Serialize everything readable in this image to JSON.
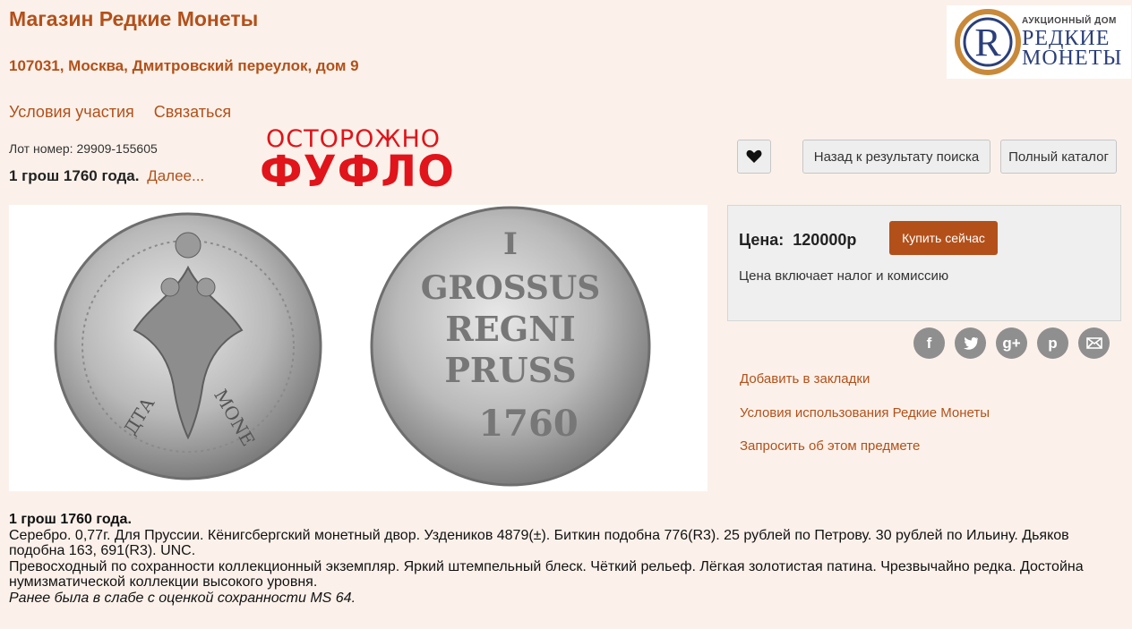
{
  "header": {
    "shop_title": "Магазин Редкие Монеты",
    "address": "107031, Москва, Дмитровский переулок, дом 9"
  },
  "logo": {
    "line1": "АУКЦИОННЫЙ ДОМ",
    "line2": "РЕДКИЕ",
    "line3": "МОНЕТЫ"
  },
  "nav": {
    "terms": "Условия участия",
    "contact": "Связаться"
  },
  "lot": {
    "number_text": "Лот номер: 29909-155605",
    "title": "1 грош 1760 года.",
    "more": "Далее..."
  },
  "overlay": {
    "top": "ОСТОРОЖНО",
    "main": "ФУФЛО"
  },
  "toolbar": {
    "back_label": "Назад к результату поиска",
    "catalog_label": "Полный каталог"
  },
  "coin": {
    "reverse_lines": [
      "I",
      "GROSSUS",
      "REGNI",
      "PRUSS",
      "1760"
    ]
  },
  "price": {
    "label": "Цена:",
    "value": "120000р",
    "buy_label": "Купить сейчас",
    "note": "Цена включает налог и комиссию"
  },
  "social": [
    "facebook-icon",
    "twitter-icon",
    "google-plus-icon",
    "pinterest-icon",
    "email-icon"
  ],
  "links": {
    "bookmark": "Добавить в закладки",
    "terms_of_use": "Условия использования Редкие Монеты",
    "inquire": "Запросить об этом предмете"
  },
  "description": {
    "title": "1 грош 1760 года.",
    "line1": "Серебро. 0,77г. Для Пруссии. Кёнигсбергский монетный двор. Уздеников 4879(±). Биткин подобна 776(R3). 25 рублей по Петрову. 30 рублей по Ильину. Дьяков подобна 163, 691(R3). UNC.",
    "line2": "Превосходный по сохранности коллекционный экземпляр. Яркий штемпельный блеск. Чёткий рельеф. Лёгкая золотистая патина. Чрезвычайно редка. Достойна нумизматической коллекции высокого уровня.",
    "line3": "Ранее была в слабе с оценкой сохранности MS 64."
  },
  "colors": {
    "accent": "#b3501a",
    "warning": "#e0141a",
    "background": "#fbf1ea"
  }
}
